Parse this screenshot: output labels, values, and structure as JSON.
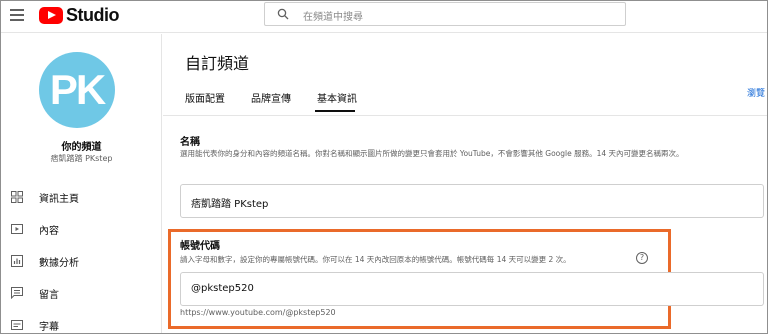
{
  "app": {
    "logo_text": "Studio",
    "search_placeholder": "在頻道中搜尋"
  },
  "sidebar": {
    "avatar_text": "PK",
    "channel_label": "你的頻道",
    "channel_name": "痞凱踏踏 PKstep",
    "items": [
      {
        "label": "資訊主頁",
        "icon": "dashboard-icon"
      },
      {
        "label": "內容",
        "icon": "content-icon"
      },
      {
        "label": "數據分析",
        "icon": "analytics-icon"
      },
      {
        "label": "留言",
        "icon": "comments-icon"
      },
      {
        "label": "字幕",
        "icon": "subtitles-icon"
      }
    ]
  },
  "main": {
    "title": "自訂頻道",
    "tabs": [
      {
        "label": "版面配置",
        "active": false
      },
      {
        "label": "品牌宣傳",
        "active": false
      },
      {
        "label": "基本資訊",
        "active": true
      }
    ],
    "preview_link": "瀏覽",
    "name_section": {
      "label": "名稱",
      "description": "選用能代表你的身分和內容的頻道名稱。你對名稱和顯示圖片所做的變更只會套用於 YouTube，不會影響其他 Google 服務。14 天內可變更名稱兩次。",
      "value": "痞凱踏踏 PKstep"
    },
    "handle_section": {
      "label": "帳號代碼",
      "description": "請入字母和數字，設定你的專屬帳號代碼。你可以在 14 天內改回原本的帳號代碼。帳號代碼每 14 天可以變更 2 次。",
      "help_glyph": "?",
      "value": "@pkstep520",
      "url": "https://www.youtube.com/@pkstep520"
    }
  },
  "colors": {
    "brand_red": "#ff0000",
    "avatar_bg": "#6fc8e6",
    "highlight": "#ea6a2a",
    "link": "#065fd4"
  }
}
